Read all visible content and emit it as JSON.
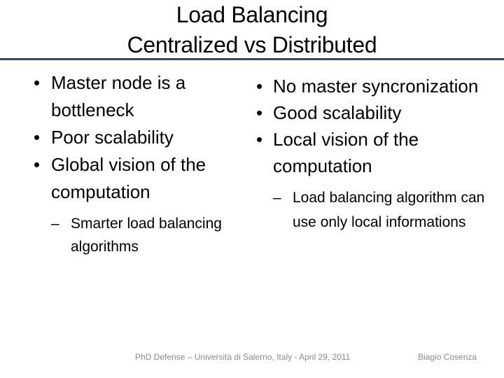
{
  "slide": {
    "title_lines": [
      "Load Balancing",
      "Centralized vs Distributed"
    ],
    "rule_color": "#2f4b6b",
    "left_column": {
      "bullets": [
        "Master node is a bottleneck",
        "Poor scalability",
        "Global vision of the computation"
      ],
      "sub_bullets": [
        "Smarter load balancing algorithms"
      ]
    },
    "right_column": {
      "bullets": [
        "No master syncronization",
        "Good scalability",
        "Local vision of the computation"
      ],
      "sub_bullets": [
        "Load balancing algorithm can use only local informations"
      ]
    },
    "bullet_glyph": "•",
    "sub_bullet_glyph": "–",
    "footer": {
      "event": "PhD Defense – Università di Salerno, Italy - April 29, 2011",
      "author": "Biagio Cosenza"
    }
  }
}
